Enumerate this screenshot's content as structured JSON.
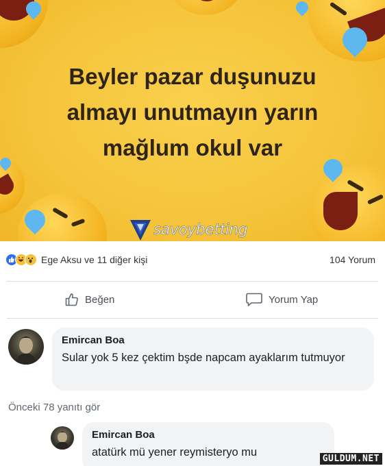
{
  "meme": {
    "text_lines": [
      "Beyler pazar duşunuzu",
      "almayı unutmayın yarın",
      "mağlum okul var"
    ],
    "background_color": "#f5c43a",
    "text_color": "#2e2418",
    "watermark": {
      "text": "savoybetting",
      "icon": "savoy-logo-icon"
    }
  },
  "post": {
    "reactions": {
      "icons": [
        "like-icon",
        "haha-icon",
        "wow-icon"
      ],
      "likers_text": "Ege Aksu ve 11 diğer kişi",
      "comment_count": "104 Yorum"
    },
    "actions": {
      "like_label": "Beğen",
      "comment_label": "Yorum Yap"
    },
    "comments": [
      {
        "author": "Emircan Boa",
        "text": "Sular yok 5 kez çektim bşde napcam ayaklarım tutmuyor"
      }
    ],
    "previous_replies": "Önceki 78 yanıtı gör",
    "replies": [
      {
        "author": "Emircan Boa",
        "text": "atatürk mü yener reymisteryo mu"
      }
    ]
  },
  "site_watermark": "GULDUM.NET",
  "colors": {
    "like_blue": "#2d6ef2",
    "bubble": "#f2f3f5",
    "secondary_text": "#606770"
  }
}
